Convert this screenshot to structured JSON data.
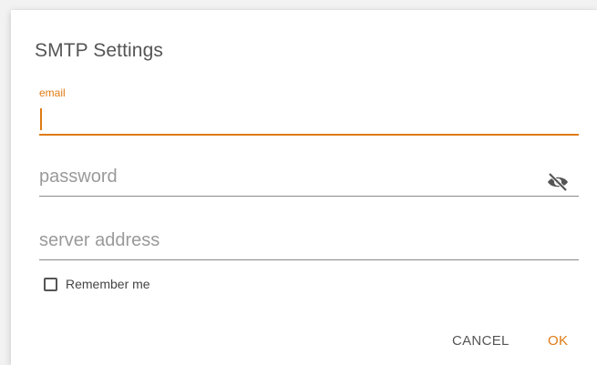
{
  "dialog": {
    "title": "SMTP Settings"
  },
  "fields": {
    "email": {
      "label": "email",
      "value": ""
    },
    "password": {
      "placeholder": "password",
      "visibility_icon": "eye-off-icon"
    },
    "server": {
      "placeholder": "server address"
    }
  },
  "remember": {
    "label": "Remember me",
    "checked": false
  },
  "actions": {
    "cancel_label": "CANCEL",
    "ok_label": "OK"
  },
  "colors": {
    "accent": "#e07b14",
    "text": "#555555",
    "underline": "#8a8a8a",
    "placeholder": "#9a9a9a"
  }
}
